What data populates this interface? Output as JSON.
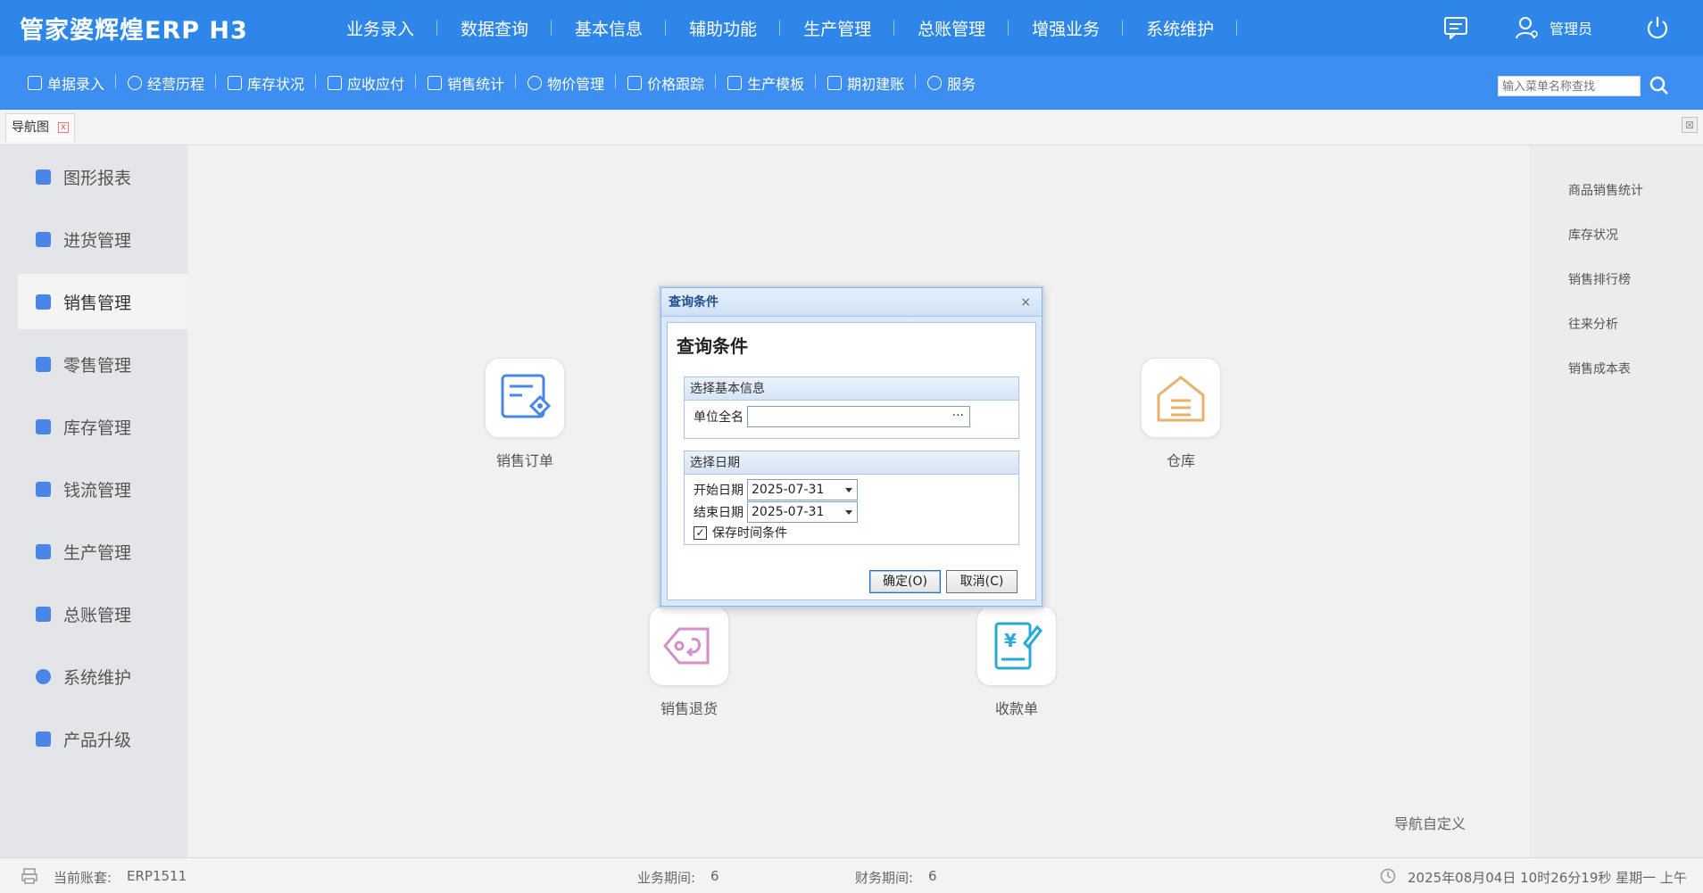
{
  "header": {
    "logo": "管家婆辉煌ERP H3",
    "nav": [
      "业务录入",
      "数据查询",
      "基本信息",
      "辅助功能",
      "生产管理",
      "总账管理",
      "增强业务",
      "系统维护"
    ],
    "user": "管理员",
    "icons": [
      "message-icon",
      "user-icon",
      "power-icon"
    ]
  },
  "toolbar": {
    "items": [
      "单据录入",
      "经营历程",
      "库存状况",
      "应收应付",
      "销售统计",
      "物价管理",
      "价格跟踪",
      "生产模板",
      "期初建账",
      "服务"
    ],
    "search_placeholder": "输入菜单名称查找"
  },
  "tabs": {
    "active": "导航图",
    "close": "x"
  },
  "sidebar": {
    "items": [
      "图形报表",
      "进货管理",
      "销售管理",
      "零售管理",
      "库存管理",
      "钱流管理",
      "生产管理",
      "总账管理",
      "系统维护",
      "产品升级"
    ],
    "active_index": 2
  },
  "right_panel": {
    "links": [
      "商品销售统计",
      "库存状况",
      "销售排行榜",
      "往来分析",
      "销售成本表"
    ]
  },
  "flow": {
    "nodes": [
      "销售订单",
      "仓库",
      "销售退货",
      "收款单"
    ],
    "custom_link": "导航自定义"
  },
  "dialog": {
    "title": "查询条件",
    "close": "×",
    "heading": "查询条件",
    "group1_title": "选择基本信息",
    "unit_label": "单位全名",
    "unit_value": "",
    "unit_btn": "···",
    "group2_title": "选择日期",
    "start_label": "开始日期",
    "start_value": "2025-07-31",
    "end_label": "结束日期",
    "end_value": "2025-07-31",
    "save_label": "保存时间条件",
    "save_checked": "✓",
    "ok": "确定(O)",
    "cancel": "取消(C)"
  },
  "status": {
    "account_label": "当前账套:",
    "account_value": "ERP1511",
    "biz_period_label": "业务期间:",
    "biz_period_value": "6",
    "fin_period_label": "财务期间:",
    "fin_period_value": "6",
    "datetime": "2025年08月04日 10时26分19秒 星期一 上午"
  },
  "colors": {
    "header_bg": "#2d86e8",
    "toolbar_bg": "#3c8ff0",
    "accent": "#4a86e8"
  }
}
